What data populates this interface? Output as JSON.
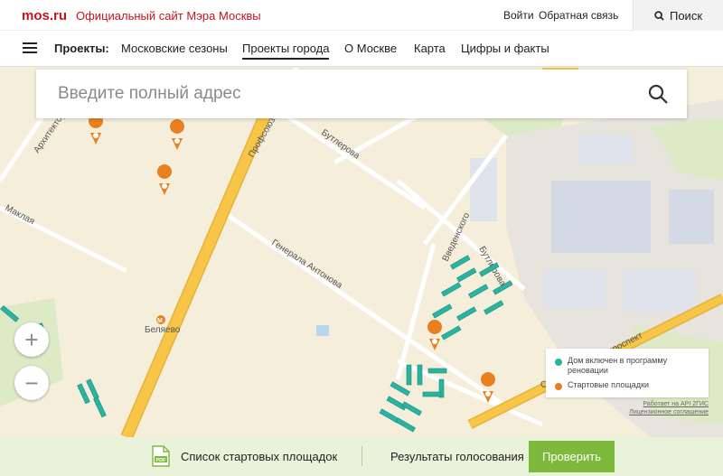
{
  "header": {
    "logo": "mos.ru",
    "site_title": "Официальный сайт Мэра Москвы",
    "login": "Войти",
    "feedback": "Обратная связь",
    "search_label": "Поиск"
  },
  "nav": {
    "label": "Проекты:",
    "items": [
      {
        "label": "Московские сезоны",
        "active": false
      },
      {
        "label": "Проекты города",
        "active": true
      },
      {
        "label": "О Москве",
        "active": false
      },
      {
        "label": "Карта",
        "active": false
      },
      {
        "label": "Цифры и факты",
        "active": false
      }
    ]
  },
  "address_search": {
    "placeholder": "Введите полный адрес"
  },
  "map": {
    "streets": {
      "butlerova_1": "Бутлерова",
      "butlerova_2": "Бутлерова",
      "generala_antonova": "Генерала Антонова",
      "vvedenskogo": "Введенского",
      "profsoyuznaya": "Профсоюзная",
      "arkhitektora_vlasova": "Архитектора Власова",
      "maklaya": "Маклая",
      "prospekt": "Севастопольский проспект"
    },
    "metro_label": "Беляево",
    "zoom_in": "+",
    "zoom_out": "−"
  },
  "legend": {
    "items": [
      {
        "label": "Дом включен в программу реновации",
        "color": "#2ab3a1"
      },
      {
        "label": "Стартовые площадки",
        "color": "#e8801f"
      }
    ],
    "attribution_1": "Работает на API 2ГИС",
    "attribution_2": "Лицензионное соглашение"
  },
  "bottom": {
    "pdf_badge": "PDF",
    "list_link": "Список стартовых площадок",
    "results_label": "Результаты голосования",
    "check_button": "Проверить"
  },
  "colors": {
    "brand_red": "#c4161c",
    "accent_green": "#7dba3c",
    "renovation_teal": "#2ab3a1",
    "pin_orange": "#e8801f",
    "major_road": "#f7c548"
  }
}
